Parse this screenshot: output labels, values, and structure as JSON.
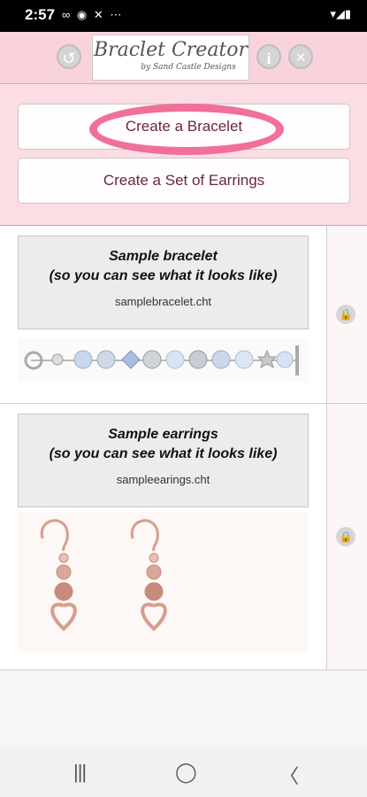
{
  "status": {
    "time": "2:57",
    "left_icons": "∞ ◉ ✕ ⋯",
    "right_icons": "▾◢▮"
  },
  "header": {
    "logo_title": "Braclet Creator",
    "logo_sub": "by Sand Castle Designs",
    "back_icon": "↺",
    "info_icon": "i",
    "close_icon": "✕"
  },
  "actions": {
    "create_bracelet": "Create a Bracelet",
    "create_earrings": "Create a Set of Earrings"
  },
  "items": [
    {
      "title": "Sample bracelet",
      "subtitle": "(so you can see what it looks like)",
      "file": "samplebracelet.cht"
    },
    {
      "title": "Sample earrings",
      "subtitle": "(so you can see what it looks like)",
      "file": "sampleearings.cht"
    }
  ],
  "lock_icon": "🔒",
  "nav": {
    "recents": "|||",
    "home": "◯",
    "back": "〈"
  },
  "colors": {
    "header_bg": "#f9d3db",
    "button_text": "#6b2540",
    "highlight_ring": "#f16f9a"
  }
}
